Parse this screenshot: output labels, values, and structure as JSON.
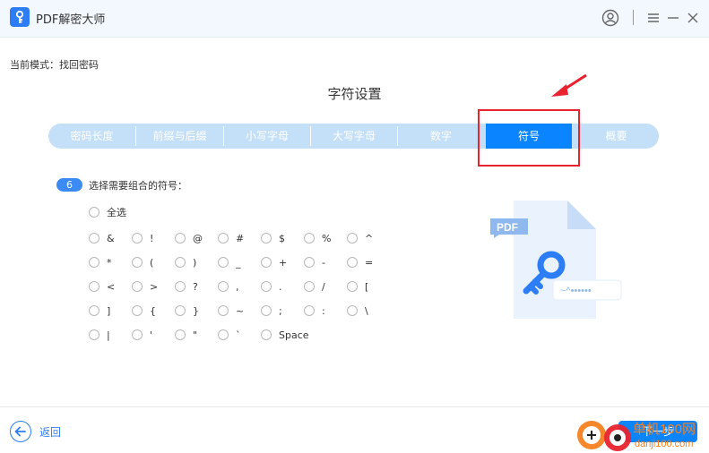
{
  "app": {
    "title": "PDF解密大师"
  },
  "mode": {
    "label": "当前模式：找回密码"
  },
  "page": {
    "title": "字符设置"
  },
  "tabs": [
    {
      "label": "密码长度"
    },
    {
      "label": "前缀与后缀"
    },
    {
      "label": "小写字母"
    },
    {
      "label": "大写字母"
    },
    {
      "label": "数字"
    },
    {
      "label": "符号"
    },
    {
      "label": "概要"
    }
  ],
  "active_tab": "符号",
  "section": {
    "step_number": "6",
    "prompt": "选择需要组合的符号："
  },
  "select_all": {
    "label": "全选"
  },
  "symbols": [
    "&",
    "!",
    "@",
    "#",
    "$",
    "%",
    "^",
    "*",
    "(",
    ")",
    "_",
    "+",
    "-",
    "=",
    "<",
    ">",
    "?",
    ",",
    ".",
    "/",
    "[",
    "]",
    "{",
    "}",
    "~",
    ";",
    ":",
    "\\",
    "|",
    "'",
    "\"",
    "`",
    "Space"
  ],
  "illustration": {
    "badge_text": "PDF",
    "password_mask": "~^••••••"
  },
  "footer": {
    "back_label": "返回",
    "next_label": "下一步"
  },
  "watermark": {
    "site_name": "单机100网",
    "site_url": "danji100.com"
  },
  "colors": {
    "accent": "#0a84ff",
    "tab_bar": "#c4dff8",
    "highlight": "#e8232f",
    "titlebar": "#f3f8fe"
  },
  "icons": [
    "app-logo-icon",
    "user-icon",
    "menu-icon",
    "minimize-icon",
    "close-icon",
    "back-arrow-icon",
    "key-icon",
    "pdf-file-icon"
  ]
}
